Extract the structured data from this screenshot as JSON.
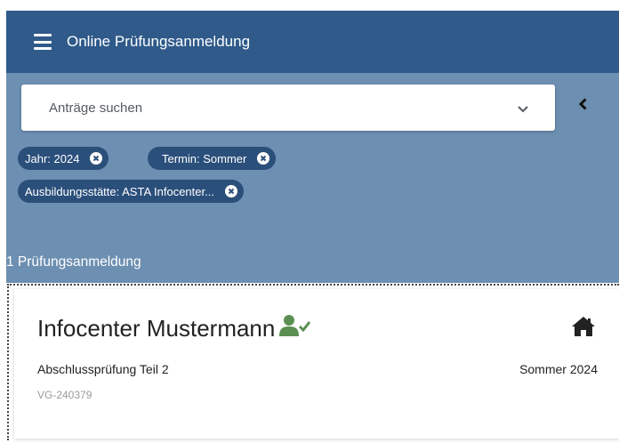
{
  "app": {
    "title": "Online Prüfungsanmeldung"
  },
  "search": {
    "placeholder": "Anträge suchen"
  },
  "filters": [
    {
      "label": "Jahr: 2024"
    },
    {
      "label": "Termin: Sommer"
    },
    {
      "label": "Ausbildungsstätte: ASTA Infocenter..."
    }
  ],
  "results": {
    "count_label": "1 Prüfungsanmeldung"
  },
  "card": {
    "name": "Infocenter Mustermann",
    "exam_type": "Abschlussprüfung Teil 2",
    "term": "Sommer 2024",
    "record_id": "VG-240379"
  },
  "colors": {
    "header_bg": "#2f5a8a",
    "panel_bg": "#6d8fb1",
    "chip_bg": "#2b4f7b",
    "status_green": "#5b8f52"
  },
  "icons": {
    "menu": "hamburger-icon",
    "dropdown": "chevron-down-icon",
    "collapse": "chevron-left-icon",
    "chip_remove": "close-circle-icon",
    "status": "user-check-icon",
    "location": "home-icon"
  }
}
